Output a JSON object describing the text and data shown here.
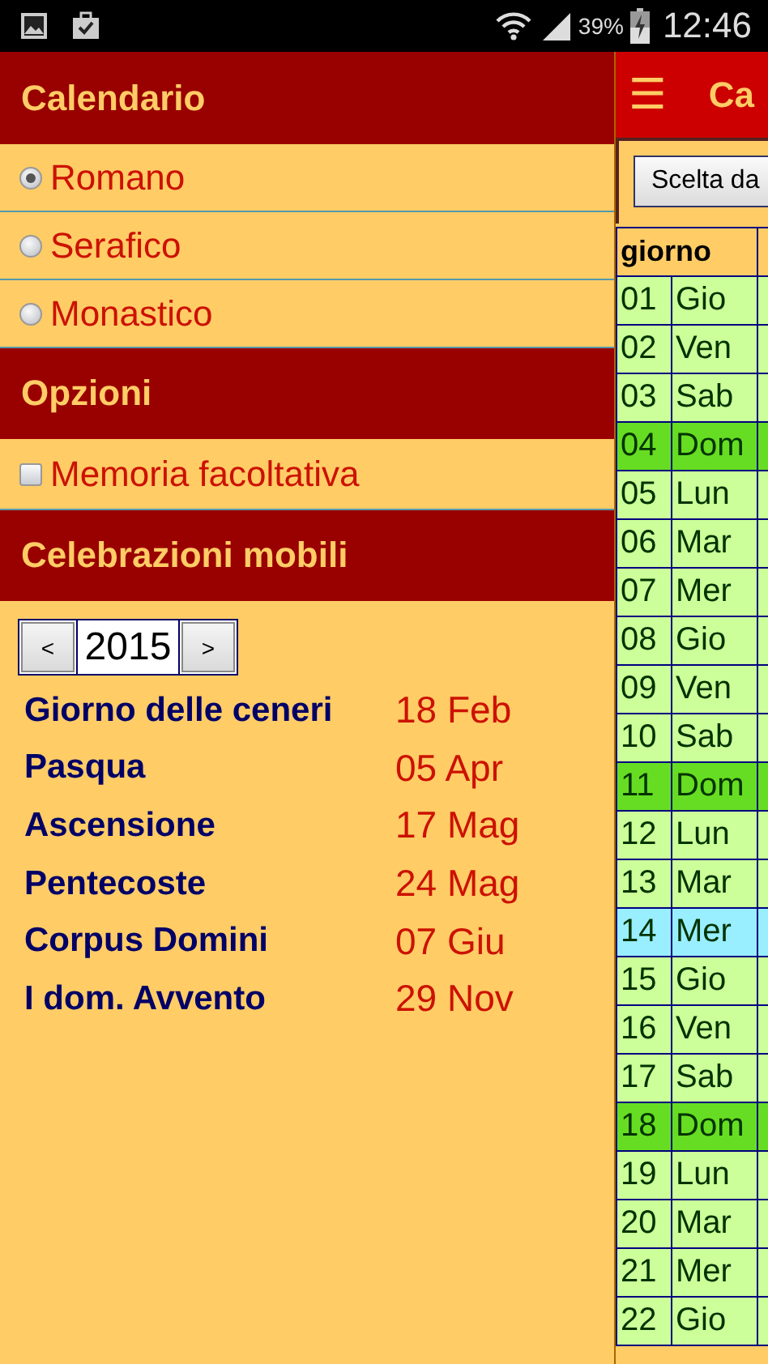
{
  "status_bar": {
    "battery_percent": "39%",
    "time": "12:46"
  },
  "drawer": {
    "title": "Calendario",
    "calendars": [
      {
        "label": "Romano",
        "selected": true
      },
      {
        "label": "Serafico",
        "selected": false
      },
      {
        "label": "Monastico",
        "selected": false
      }
    ],
    "options_title": "Opzioni",
    "options": [
      {
        "label": "Memoria facoltativa",
        "checked": false
      }
    ],
    "movable_title": "Celebrazioni mobili",
    "year_stepper": {
      "prev": "<",
      "year": "2015",
      "next": ">"
    },
    "celebrations": [
      {
        "name": "Giorno delle ceneri",
        "date": "18 Feb"
      },
      {
        "name": "Pasqua",
        "date": "05 Apr"
      },
      {
        "name": "Ascensione",
        "date": "17 Mag"
      },
      {
        "name": "Pentecoste",
        "date": "24 Mag"
      },
      {
        "name": "Corpus Domini",
        "date": "07 Giu"
      },
      {
        "name": "I dom. Avvento",
        "date": "29 Nov"
      }
    ]
  },
  "main": {
    "menu_glyph": "☰",
    "title": "Ca",
    "select_button": "Scelta da",
    "table": {
      "columns": [
        "giorno"
      ],
      "rows": [
        {
          "day": "01",
          "weekday": "Gio",
          "kind": "weekday"
        },
        {
          "day": "02",
          "weekday": "Ven",
          "kind": "weekday"
        },
        {
          "day": "03",
          "weekday": "Sab",
          "kind": "weekday"
        },
        {
          "day": "04",
          "weekday": "Dom",
          "kind": "sunday"
        },
        {
          "day": "05",
          "weekday": "Lun",
          "kind": "weekday"
        },
        {
          "day": "06",
          "weekday": "Mar",
          "kind": "weekday"
        },
        {
          "day": "07",
          "weekday": "Mer",
          "kind": "weekday"
        },
        {
          "day": "08",
          "weekday": "Gio",
          "kind": "weekday"
        },
        {
          "day": "09",
          "weekday": "Ven",
          "kind": "weekday"
        },
        {
          "day": "10",
          "weekday": "Sab",
          "kind": "weekday"
        },
        {
          "day": "11",
          "weekday": "Dom",
          "kind": "sunday"
        },
        {
          "day": "12",
          "weekday": "Lun",
          "kind": "weekday"
        },
        {
          "day": "13",
          "weekday": "Mar",
          "kind": "weekday"
        },
        {
          "day": "14",
          "weekday": "Mer",
          "kind": "today"
        },
        {
          "day": "15",
          "weekday": "Gio",
          "kind": "weekday"
        },
        {
          "day": "16",
          "weekday": "Ven",
          "kind": "weekday"
        },
        {
          "day": "17",
          "weekday": "Sab",
          "kind": "weekday"
        },
        {
          "day": "18",
          "weekday": "Dom",
          "kind": "sunday"
        },
        {
          "day": "19",
          "weekday": "Lun",
          "kind": "weekday"
        },
        {
          "day": "20",
          "weekday": "Mar",
          "kind": "weekday"
        },
        {
          "day": "21",
          "weekday": "Mer",
          "kind": "weekday"
        },
        {
          "day": "22",
          "weekday": "Gio",
          "kind": "weekday"
        }
      ]
    }
  }
}
